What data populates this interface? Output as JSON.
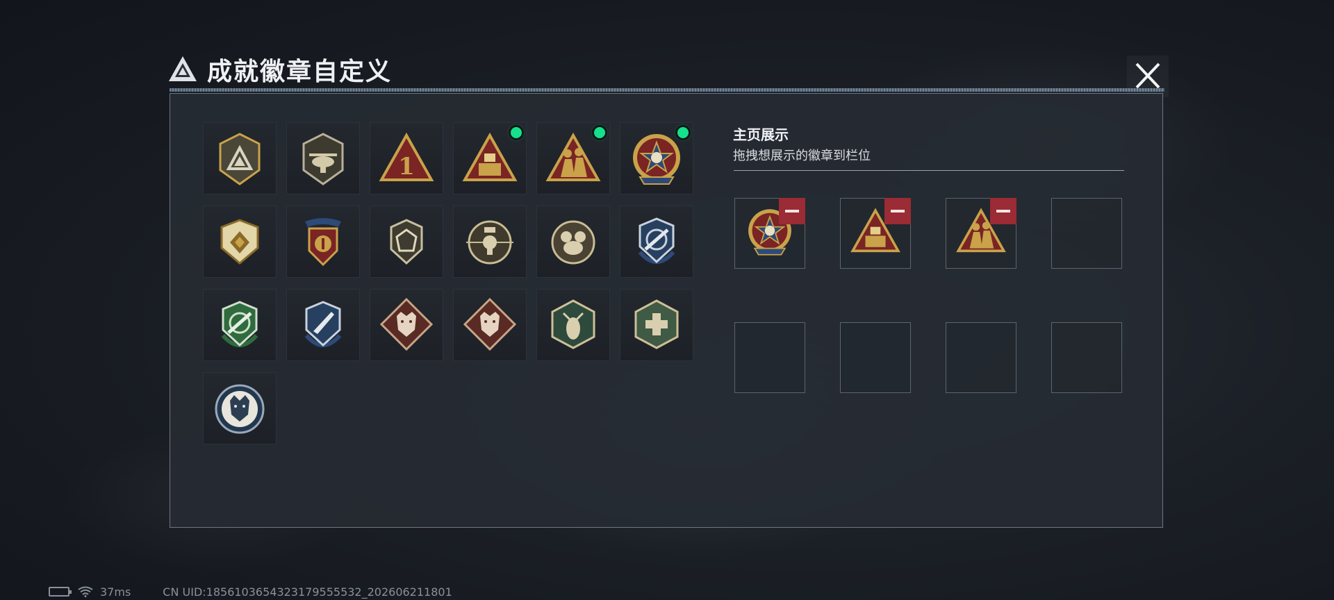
{
  "header": {
    "title": "成就徽章自定义",
    "logo_icon": "triangle-emblem-icon",
    "close_icon": "close-icon"
  },
  "badges": [
    {
      "icon": "shield-triangle-emblem",
      "new": false
    },
    {
      "icon": "helicopter-shield",
      "new": false
    },
    {
      "icon": "triangle-number-one",
      "new": false,
      "text": "1"
    },
    {
      "icon": "triangle-tower",
      "new": true
    },
    {
      "icon": "triangle-soldiers",
      "new": true
    },
    {
      "icon": "round-skull-star",
      "new": true
    },
    {
      "icon": "shield-diamond-gold",
      "new": false
    },
    {
      "icon": "laurel-shield-gold",
      "new": false
    },
    {
      "icon": "shield-dice",
      "new": false
    },
    {
      "icon": "round-sniper-skull",
      "new": false
    },
    {
      "icon": "round-ornate-skull",
      "new": false
    },
    {
      "icon": "shield-rifle-blue",
      "new": false
    },
    {
      "icon": "shield-rifle-green",
      "new": false
    },
    {
      "icon": "shield-knife-blue",
      "new": false
    },
    {
      "icon": "diamond-wolf-red",
      "new": false
    },
    {
      "icon": "diamond-wolf-red-2",
      "new": false
    },
    {
      "icon": "hexagon-hornet",
      "new": false
    },
    {
      "icon": "hexagon-medic",
      "new": false
    },
    {
      "icon": "round-wolf-blue",
      "new": false
    }
  ],
  "showcase": {
    "title": "主页展示",
    "subtitle": "拖拽想展示的徽章到栏位",
    "slots": [
      {
        "badge": "round-skull-star",
        "removable": true
      },
      {
        "badge": "triangle-tower",
        "removable": true
      },
      {
        "badge": "triangle-soldiers",
        "removable": true
      },
      {
        "badge": "",
        "removable": false
      },
      {
        "badge": "",
        "removable": false
      },
      {
        "badge": "",
        "removable": false
      },
      {
        "badge": "",
        "removable": false
      },
      {
        "badge": "",
        "removable": false
      }
    ]
  },
  "status": {
    "battery_icon": "battery-charging-icon",
    "wifi_icon": "wifi-icon",
    "ping": "37ms",
    "uid": "CN UID:1856103654323179555532_202606211801"
  },
  "colors": {
    "new_dot": "#16e08c",
    "remove": "#9b2b34",
    "gold": "#c9a24a"
  }
}
